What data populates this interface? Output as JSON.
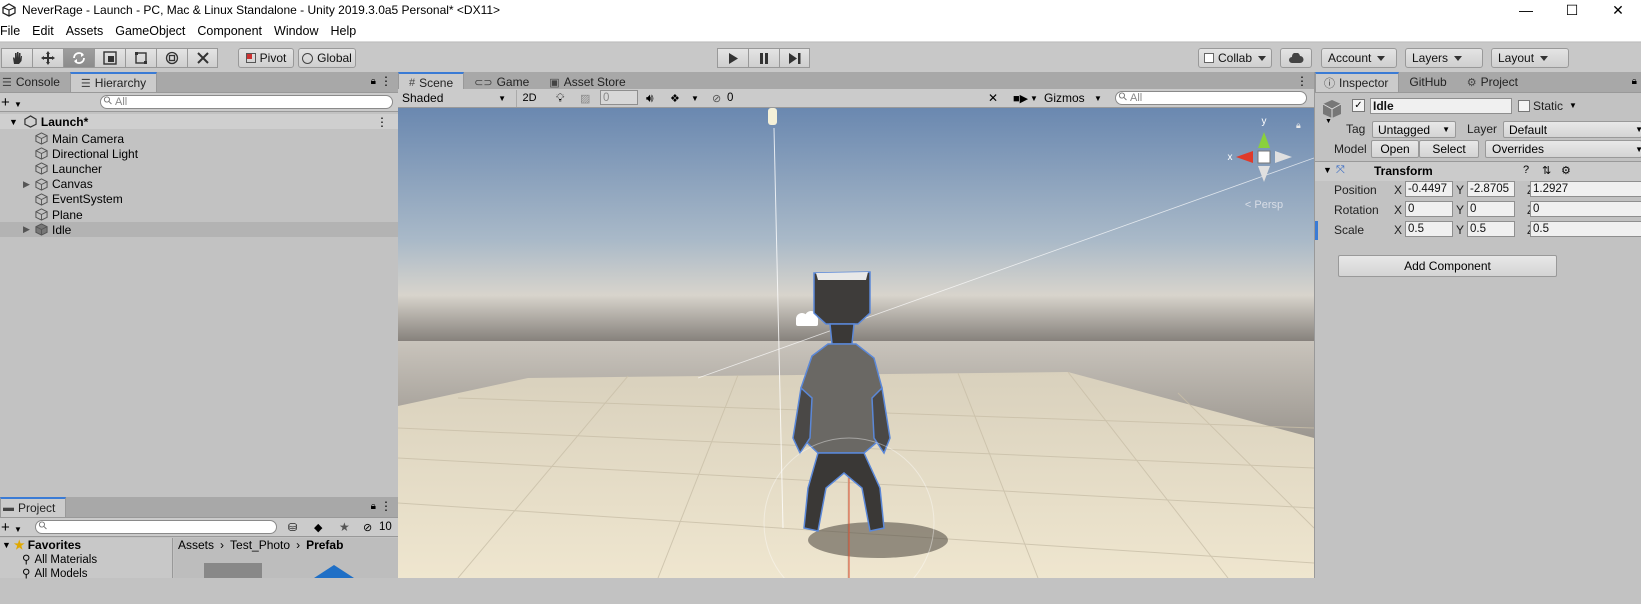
{
  "window": {
    "title": "NeverRage - Launch - PC, Mac & Linux Standalone - Unity 2019.3.0a5 Personal* <DX11>",
    "minimize": "—",
    "maximize": "☐",
    "close": "✕"
  },
  "menu": [
    "File",
    "Edit",
    "Assets",
    "GameObject",
    "Component",
    "Window",
    "Help"
  ],
  "toolbar": {
    "pivot": "Pivot",
    "global": "Global",
    "collab": "Collab",
    "account": "Account",
    "layers": "Layers",
    "layout": "Layout"
  },
  "left_tabs": {
    "console": "Console",
    "hierarchy": "Hierarchy"
  },
  "hierarchy": {
    "search_placeholder": "All",
    "scene": "Launch*",
    "items": [
      {
        "label": "Main Camera",
        "expandable": false
      },
      {
        "label": "Directional Light",
        "expandable": false
      },
      {
        "label": "Launcher",
        "expandable": false
      },
      {
        "label": "Canvas",
        "expandable": true
      },
      {
        "label": "EventSystem",
        "expandable": false
      },
      {
        "label": "Plane",
        "expandable": false
      },
      {
        "label": "Idle",
        "expandable": true,
        "selected": true
      }
    ]
  },
  "project": {
    "tab": "Project",
    "hidden_count": "10",
    "favorites": "Favorites",
    "fav_items": [
      "All Materials",
      "All Models"
    ],
    "breadcrumb": [
      "Assets",
      "Test_Photo",
      "Prefab"
    ]
  },
  "scene_tabs": {
    "scene": "Scene",
    "game": "Game",
    "asset_store": "Asset Store"
  },
  "scene_bar": {
    "shading": "Shaded",
    "mode_2d": "2D",
    "fx_value": "0",
    "hidden_value": "0",
    "gizmos": "Gizmos",
    "search_placeholder": "All"
  },
  "gizmo": {
    "y": "y",
    "x": "x",
    "persp": "< Persp"
  },
  "right_tabs": {
    "inspector": "Inspector",
    "github": "GitHub",
    "project": "Project"
  },
  "inspector": {
    "object_name": "Idle",
    "static_label": "Static",
    "tag_label": "Tag",
    "tag_value": "Untagged",
    "layer_label": "Layer",
    "layer_value": "Default",
    "model_label": "Model",
    "open": "Open",
    "select": "Select",
    "overrides": "Overrides",
    "transform_title": "Transform",
    "position_label": "Position",
    "rotation_label": "Rotation",
    "scale_label": "Scale",
    "position": {
      "x": "-0.4497",
      "y": "-2.8705",
      "z": "1.2927"
    },
    "rotation": {
      "x": "0",
      "y": "0",
      "z": "0"
    },
    "scale": {
      "x": "0.5",
      "y": "0.5",
      "z": "0.5"
    },
    "axis_x": "X",
    "axis_y": "Y",
    "axis_z": "Z",
    "add_component": "Add Component"
  },
  "colors": {
    "accent": "#3a7bd5",
    "panel": "#c2c2c2",
    "sky_top": "#6f8db5",
    "ground": "#e6dcc4"
  }
}
